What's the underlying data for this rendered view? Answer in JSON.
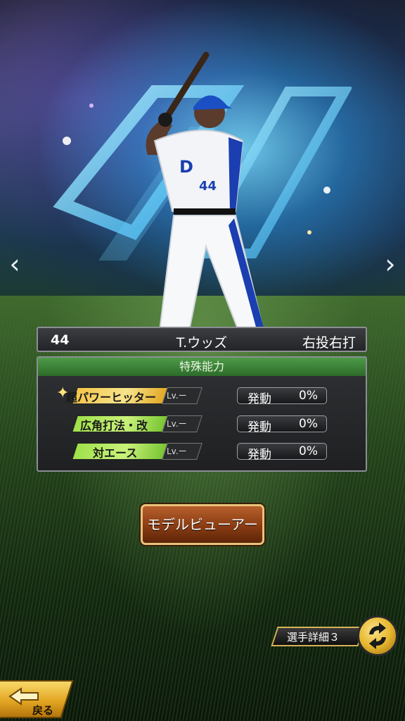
{
  "player": {
    "number": "44",
    "name": "T.ウッズ",
    "handedness": "右投右打",
    "uniform_text": "D",
    "uniform_number": "44"
  },
  "abilities": {
    "header": "特殊能力",
    "items": [
      {
        "name": "超パワーヒッター",
        "prefix": "超",
        "lv": "Lv.ー",
        "trigger_label": "発動",
        "trigger_value": "0%",
        "tier": "gold"
      },
      {
        "name": "広角打法・改",
        "lv": "Lv.ー",
        "trigger_label": "発動",
        "trigger_value": "0%",
        "tier": "green"
      },
      {
        "name": "対エース",
        "lv": "Lv.ー",
        "trigger_label": "発動",
        "trigger_value": "0%",
        "tier": "green"
      }
    ]
  },
  "buttons": {
    "model_viewer": "モデルビューアー",
    "player_details": "選手詳細３",
    "back": "戻る"
  },
  "nav": {
    "prev": "‹",
    "next": "›"
  },
  "colors": {
    "ability_header": "#3f8a3a",
    "gold_tag": "#f3c54a",
    "green_tag": "#9fe04a",
    "button_brown": "#8a3c13"
  }
}
